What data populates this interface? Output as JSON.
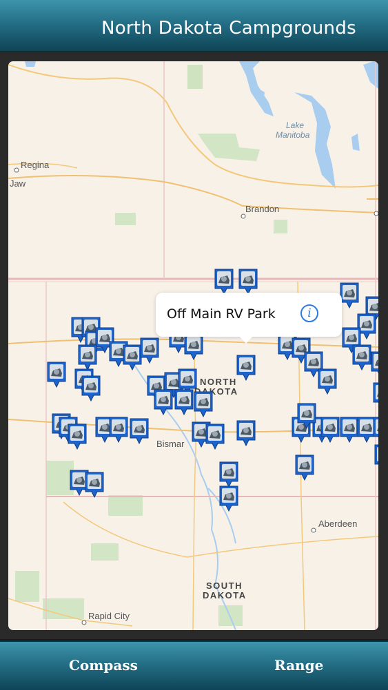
{
  "header": {
    "title": "North Dakota Campgrounds"
  },
  "map": {
    "labels": {
      "regina": "Regina",
      "jaw": "Jaw",
      "lake_manitoba_1": "Lake",
      "lake_manitoba_2": "Manitoba",
      "brandon": "Brandon",
      "north_dakota_1": "NORTH",
      "north_dakota_2": "DAKOTA",
      "bismarck": "Bismar",
      "aberdeen": "Aberdeen",
      "south_dakota_1": "SOUTH",
      "south_dakota_2": "DAKOTA",
      "rapid_city": "Rapid City"
    },
    "callout": {
      "title": "Off Main RV Park",
      "info_glyph": "i"
    },
    "pin_icon": "campground-pin-icon",
    "pin_color": "#1e63c9"
  },
  "footer": {
    "compass_label": "Compass",
    "range_label": "Range"
  }
}
